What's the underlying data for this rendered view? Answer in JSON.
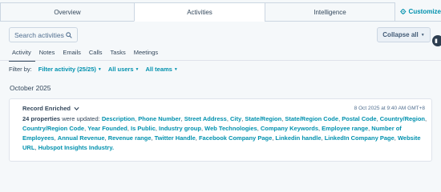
{
  "tabs": [
    {
      "label": "Overview"
    },
    {
      "label": "Activities"
    },
    {
      "label": "Intelligence"
    }
  ],
  "customize_label": "Customize",
  "search": {
    "placeholder": "Search activities"
  },
  "collapse_label": "Collapse all",
  "subtabs": [
    {
      "label": "Activity"
    },
    {
      "label": "Notes"
    },
    {
      "label": "Emails"
    },
    {
      "label": "Calls"
    },
    {
      "label": "Tasks"
    },
    {
      "label": "Meetings"
    }
  ],
  "filters": {
    "label": "Filter by:",
    "activity": "Filter activity (25/25)",
    "users": "All users",
    "teams": "All teams"
  },
  "month": "October 2025",
  "card": {
    "title": "Record Enriched",
    "timestamp": "8 Oct 2025 at 9:40 AM GMT+8",
    "count_text": "24 properties",
    "intro_text": " were updated: ",
    "properties": [
      "Description",
      "Phone Number",
      "Street Address",
      "City",
      "State/Region",
      "State/Region Code",
      "Postal Code",
      "Country/Region",
      "Country/Region Code",
      "Year Founded",
      "Is Public",
      "Industry group",
      "Web Technologies",
      "Company Keywords",
      "Employee range",
      "Number of Employees",
      "Annual Revenue",
      "Revenue range",
      "Twitter Handle",
      "Facebook Company Page",
      "Linkedin handle",
      "LinkedIn Company Page",
      "Website URL",
      "Hubspot Insights Industry."
    ]
  },
  "colors": {
    "link": "#0091ae",
    "text": "#33475b",
    "background": "#f5f8fa"
  }
}
